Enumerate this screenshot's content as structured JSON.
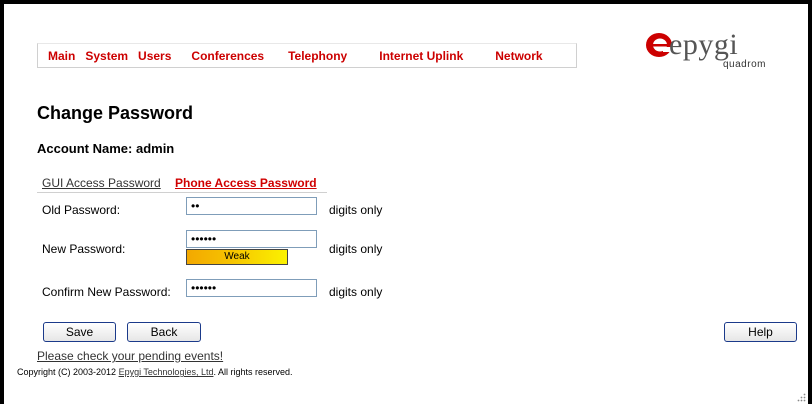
{
  "menu": [
    "Main",
    "System",
    "Users",
    "Conferences",
    "Telephony",
    "Internet Uplink",
    "Network"
  ],
  "logo": {
    "brand": "epygi",
    "sub": "quadrom",
    "accent": "#cc0000"
  },
  "page": {
    "title": "Change Password",
    "account": "Account Name: admin"
  },
  "tabs": {
    "gui": "GUI Access Password",
    "phone": "Phone Access Password"
  },
  "form": {
    "old_label": "Old Password:",
    "old_value": "••",
    "new_label": "New Password:",
    "new_value": "••••••",
    "confirm_label": "Confirm New Password:",
    "confirm_value": "••••••",
    "hint": "digits only",
    "strength": "Weak"
  },
  "buttons": {
    "save": "Save",
    "back": "Back",
    "help": "Help"
  },
  "footer": {
    "pending": "Please check your pending events!",
    "copyright_pre": "Copyright (C) 2003-2012 ",
    "company": "Epygi Technologies, Ltd",
    "copyright_post": ". All rights reserved."
  }
}
